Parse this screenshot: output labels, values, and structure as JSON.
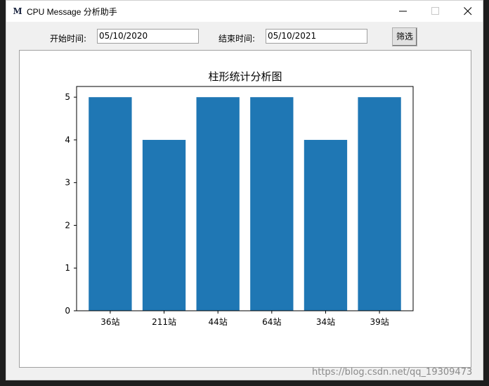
{
  "window": {
    "title": "CPU Message 分析助手",
    "app_icon_glyph": "M"
  },
  "toolbar": {
    "start_label": "开始时间:",
    "start_value": "05/10/2020",
    "end_label": "结束时间:",
    "end_value": "05/10/2021",
    "filter_label": "筛选"
  },
  "chart_data": {
    "type": "bar",
    "title": "柱形统计分析图",
    "categories": [
      "36站",
      "211站",
      "44站",
      "64站",
      "34站",
      "39站"
    ],
    "values": [
      5,
      4,
      5,
      5,
      4,
      5
    ],
    "ylim": [
      0,
      5.25
    ],
    "yticks": [
      0,
      1,
      2,
      3,
      4,
      5
    ],
    "xlabel": "",
    "ylabel": "",
    "grid": false,
    "bar_color": "#1f77b4"
  },
  "watermark": "https://blog.csdn.net/qq_19309473"
}
